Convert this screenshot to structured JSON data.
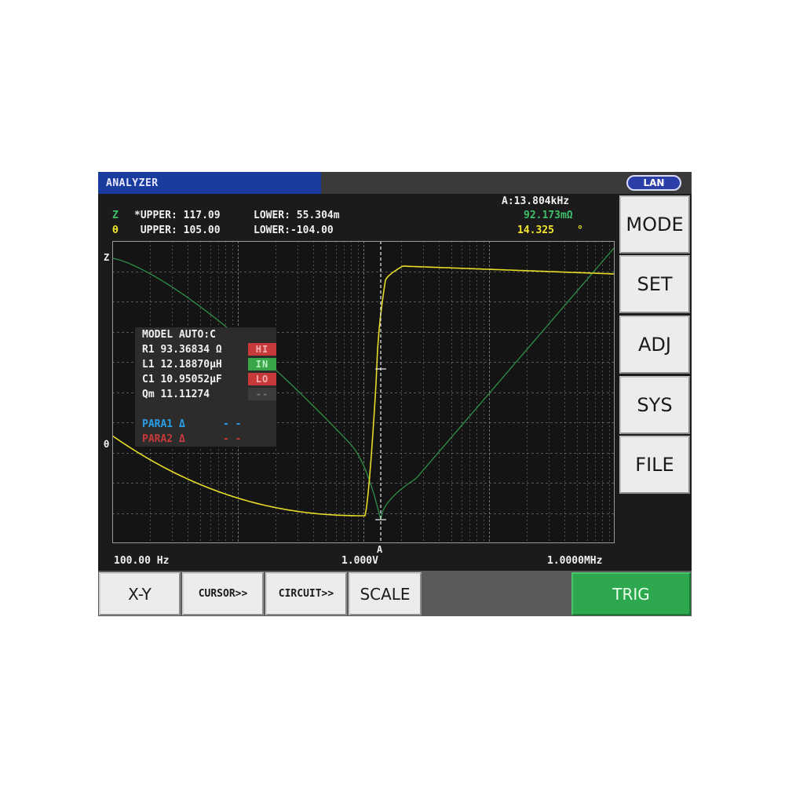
{
  "titlebar": {
    "title": "ANALYZER",
    "lan_badge": "LAN"
  },
  "header": {
    "z_row": {
      "symbol": "Z",
      "upper": "*UPPER: 117.09",
      "lower": "LOWER: 55.304m"
    },
    "theta_row": {
      "symbol": "θ",
      "upper": " UPPER: 105.00",
      "lower": "LOWER:-104.00"
    },
    "cursor_freq": "A:13.804kHz",
    "cursor_z": "92.173mΩ",
    "cursor_theta": "14.325",
    "cursor_theta_unit": "°"
  },
  "plot": {
    "z_axis_marker": "Z",
    "theta_axis_marker": "θ",
    "cursor_label": "A",
    "x_start": "100.00 Hz",
    "x_center": "1.000V",
    "x_end": "1.0000MHz"
  },
  "chart_data": {
    "type": "line",
    "x_scale": "log",
    "xlim_text": [
      "100.00 Hz",
      "1.0000MHz"
    ],
    "series": [
      {
        "name": "Z",
        "color": "#2f8f4a"
      },
      {
        "name": "θ",
        "color": "#e8dc28"
      }
    ],
    "cursor": {
      "label": "A",
      "frequency": "13.804kHz",
      "z": "92.173mΩ",
      "theta": "14.325°"
    },
    "grid": true
  },
  "model": {
    "title": "MODEL AUTO:C",
    "rows": [
      {
        "label": "R1 93.36834 Ω",
        "judge": "HI"
      },
      {
        "label": "L1 12.18870μH",
        "judge": "IN"
      },
      {
        "label": "C1 10.95052μF",
        "judge": "LO"
      },
      {
        "label": "Qm 11.11274",
        "judge": "--"
      }
    ],
    "para1": "PARA1 Δ",
    "para1_value": "- -",
    "para2": "PARA2 Δ",
    "para2_value": "- -"
  },
  "side_buttons": [
    "MODE",
    "SET",
    "ADJ",
    "SYS",
    "FILE"
  ],
  "bottom_buttons": {
    "xy": "X-Y",
    "cursor": "CURSOR>>",
    "circuit": "CIRCUIT>>",
    "scale": "SCALE",
    "trig": "TRIG"
  },
  "colors": {
    "z_trace": "#2f8f4a",
    "theta_trace": "#e8dc28",
    "title_bar": "#1a3c9e",
    "trig_button": "#2ea84e"
  }
}
